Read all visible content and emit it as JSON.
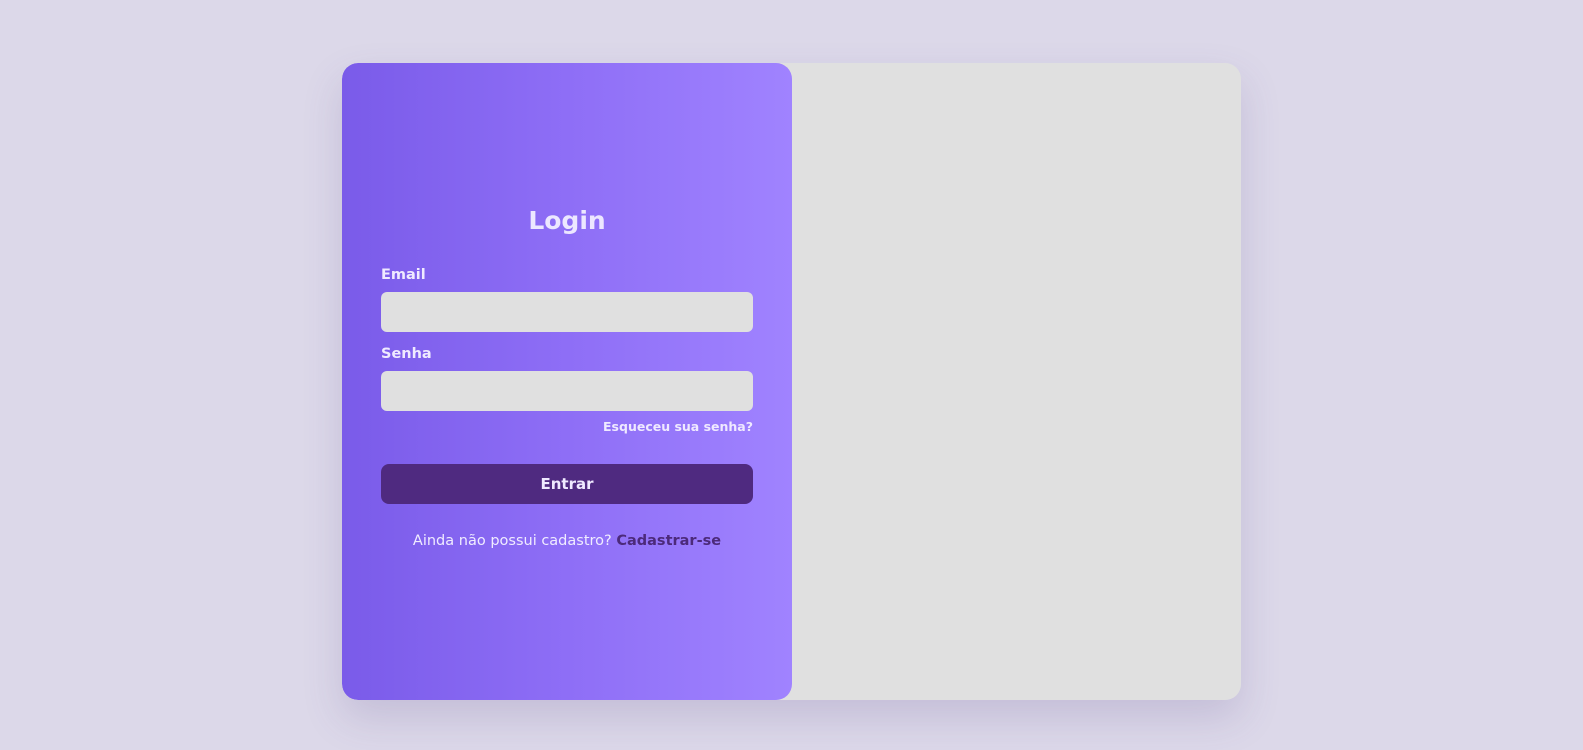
{
  "login": {
    "title": "Login",
    "email_label": "Email",
    "email_value": "",
    "password_label": "Senha",
    "password_value": "",
    "forgot_link": "Esqueceu sua senha?",
    "submit_label": "Entrar",
    "signup_prompt": "Ainda não possui cadastro?",
    "signup_link": "Cadastrar-se"
  },
  "illustration": {
    "bubble_symbol": "$"
  },
  "colors": {
    "background": "#dcd8e9",
    "panel_gradient_start": "#7a5be9",
    "panel_gradient_end": "#a083ff",
    "input_bg": "#e0e0e0",
    "button_bg": "#4f2a80",
    "link_color": "#4c2a7a"
  },
  "icons": [
    "lightbulb-icon",
    "dollar-speech-bubble-icon",
    "briefcase-icon",
    "coin-stack-icon"
  ]
}
